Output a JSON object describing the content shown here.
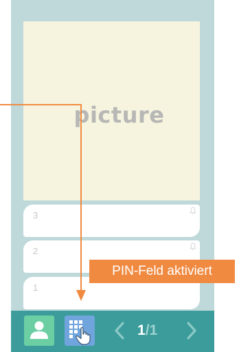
{
  "picture": {
    "label": "picture"
  },
  "name_rows": [
    {
      "number": "3",
      "icon": "bell-icon"
    },
    {
      "number": "2",
      "icon": "bell-icon"
    },
    {
      "number": "1",
      "icon": "bell-icon"
    }
  ],
  "toolbar": {
    "person_icon": "person-icon",
    "keypad_icon": "keypad-hand-icon",
    "prev_icon": "chevron-left-icon",
    "next_icon": "chevron-right-icon",
    "page_current": "1",
    "page_total": "/1"
  },
  "callout": {
    "text": "PIN-Feld aktiviert"
  },
  "colors": {
    "panel": "#bfd9da",
    "picture_bg": "#f6f4df",
    "toolbar": "#3c9c9b",
    "person_button": "#6ccfa3",
    "keypad_button": "#6fa4dd",
    "callout": "#f08a41"
  }
}
